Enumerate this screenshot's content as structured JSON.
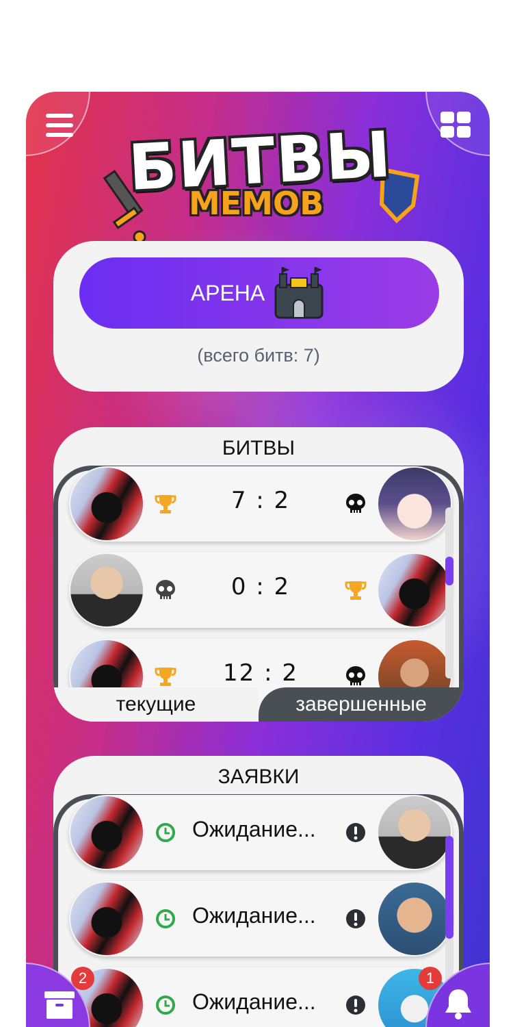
{
  "logo": {
    "title": "БИТВЫ",
    "subtitle": "МЕМОВ"
  },
  "arena": {
    "button_label": "АРЕНА",
    "total_label": "(всего битв: 7)"
  },
  "battles": {
    "title": "БИТВЫ",
    "rows": [
      {
        "left_status": "trophy-icon",
        "score_left": "7",
        "score_sep": ":",
        "score_right": "2",
        "right_status": "skull-icon"
      },
      {
        "left_status": "skull-icon",
        "score_left": "0",
        "score_sep": ":",
        "score_right": "2",
        "right_status": "trophy-icon"
      },
      {
        "left_status": "trophy-icon",
        "score_left": "12",
        "score_sep": ":",
        "score_right": "2",
        "right_status": "skull-icon"
      }
    ],
    "tabs": {
      "current": "текущие",
      "finished": "завершенные"
    }
  },
  "requests": {
    "title": "ЗАЯВКИ",
    "rows": [
      {
        "status_text": "Ожидание..."
      },
      {
        "status_text": "Ожидание..."
      },
      {
        "status_text": "Ожидание..."
      }
    ]
  },
  "badges": {
    "archive": "2",
    "notifications": "1"
  },
  "colors": {
    "accent": "#7b3df0",
    "trophy": "#f5a623",
    "clock": "#2eaa4a",
    "dark": "#4a4f55"
  }
}
